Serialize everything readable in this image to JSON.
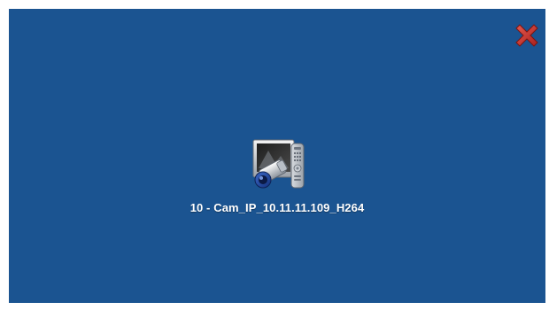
{
  "theme": {
    "background": "#1b5491",
    "text": "#ffffff",
    "close_icon_color": "#c0302b"
  },
  "toolbar": {
    "close_icon": "close-x-icon"
  },
  "device": {
    "icon": "ip-camera-with-remote-icon",
    "label": "10 - Cam_IP_10.11.11.109_H264"
  }
}
